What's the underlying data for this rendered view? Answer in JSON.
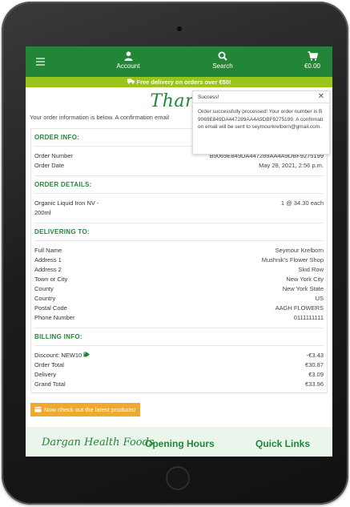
{
  "nav": {
    "account_label": "Account",
    "search_label": "Search",
    "cart_label": "€0.00"
  },
  "promo": {
    "text": "Free delivery on orders over €50!"
  },
  "page": {
    "heading": "Thank",
    "intro": "Your order information is below. A confirmation email"
  },
  "order_info": {
    "title": "ORDER INFO:",
    "order_number_label": "Order Number",
    "order_number": "B9069E849DA447289AA4A9DBF9275199",
    "order_date_label": "Order Date",
    "order_date": "May 28, 2021, 2:56 p.m."
  },
  "order_details": {
    "title": "ORDER DETAILS:",
    "item_name": "Organic Liquid Iron NV -",
    "item_size": "200ml",
    "item_qty": "1 @ 34.30 each"
  },
  "delivering": {
    "title": "DELIVERING TO:",
    "rows": [
      {
        "label": "Full Name",
        "value": "Seymour Krelborn"
      },
      {
        "label": "Address 1",
        "value": "Mushnik's Flower Shop"
      },
      {
        "label": "Address 2",
        "value": "Skid Row"
      },
      {
        "label": "Town or City",
        "value": "New York City"
      },
      {
        "label": "County",
        "value": "New York State"
      },
      {
        "label": "Country",
        "value": "US"
      },
      {
        "label": "Postal Code",
        "value": "AAGH FLOWERS"
      },
      {
        "label": "Phone Number",
        "value": "0111111111"
      }
    ]
  },
  "billing": {
    "title": "BILLING INFO:",
    "discount_label": "Discount: NEW10",
    "discount_value": "-€3.43",
    "order_total_label": "Order Total",
    "order_total": "€30.87",
    "delivery_label": "Delivery",
    "delivery": "€3.09",
    "grand_total_label": "Grand Total",
    "grand_total": "€33.96"
  },
  "cta": {
    "label": "Now check out the latest products!"
  },
  "footer": {
    "brand": "Dargan Health Foods",
    "col2": "Opening Hours",
    "col3": "Quick Links"
  },
  "toast": {
    "title": "Success!",
    "body": "Order successfully processed! Your order number is B9069E849DA447289AA4A9DBF9275199. A confirmation email will be sent to seymourkrelborn@gmail.com."
  },
  "colors": {
    "brand_green": "#238636",
    "promo_green": "#9ac61c",
    "cta_orange": "#f0a92c"
  }
}
